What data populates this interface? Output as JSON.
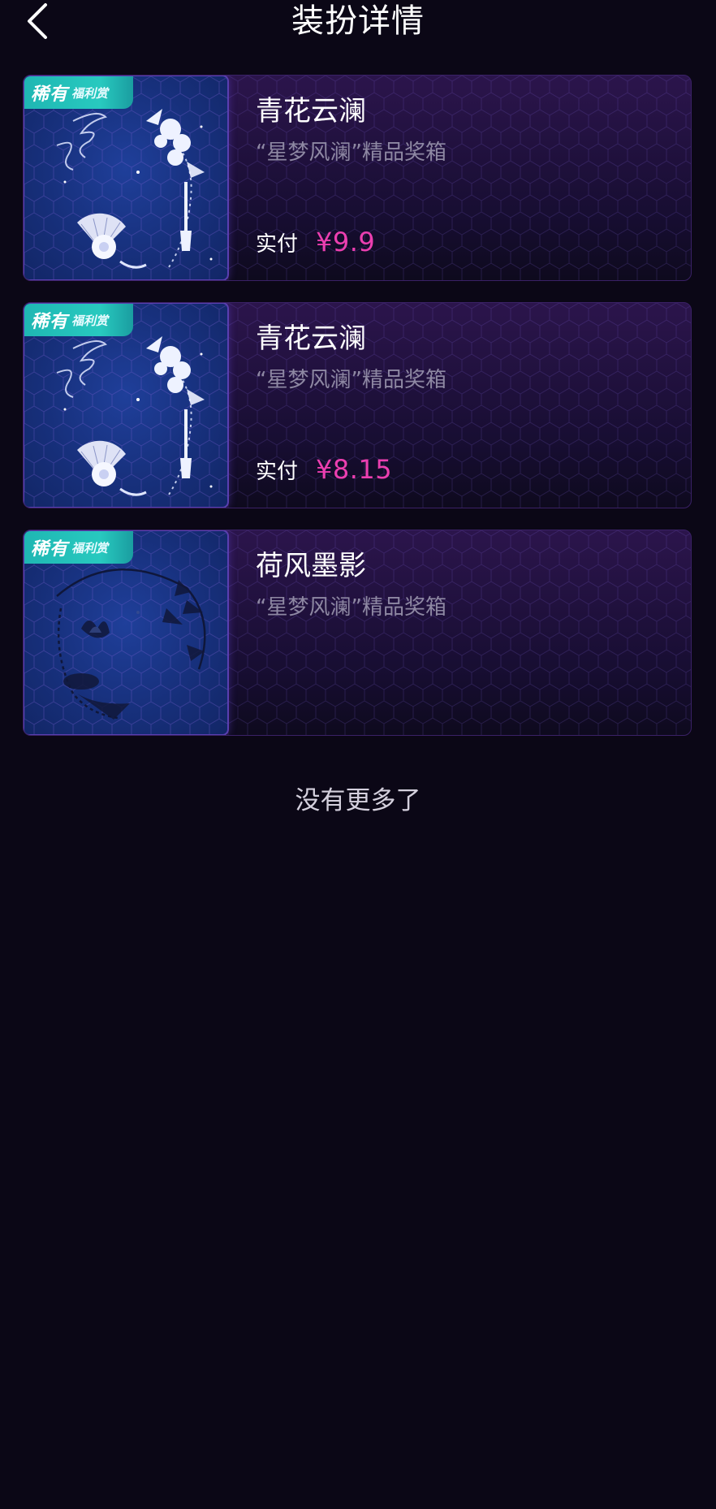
{
  "header": {
    "title": "装扮详情",
    "back_icon": "chevron-left-icon"
  },
  "items": [
    {
      "badge_main": "稀有",
      "badge_sub": "福利赏",
      "name": "青花云澜",
      "source": "“星梦风澜”精品奖箱",
      "price_label": "实付",
      "price": "¥9.9",
      "art": "fan-flower-butterfly-frame"
    },
    {
      "badge_main": "稀有",
      "badge_sub": "福利赏",
      "name": "青花云澜",
      "source": "“星梦风澜”精品奖箱",
      "price_label": "实付",
      "price": "¥8.15",
      "art": "fan-flower-butterfly-frame"
    },
    {
      "badge_main": "稀有",
      "badge_sub": "福利赏",
      "name": "荷风墨影",
      "source": "“星梦风澜”精品奖箱",
      "price_label": "",
      "price": "",
      "art": "ink-lotus-bamboo-frame"
    }
  ],
  "footer": {
    "end_text": "没有更多了"
  },
  "colors": {
    "background": "#0b0716",
    "price": "#ec3fb0",
    "badge": "#28c9bf",
    "card_border": "#3a2166"
  }
}
